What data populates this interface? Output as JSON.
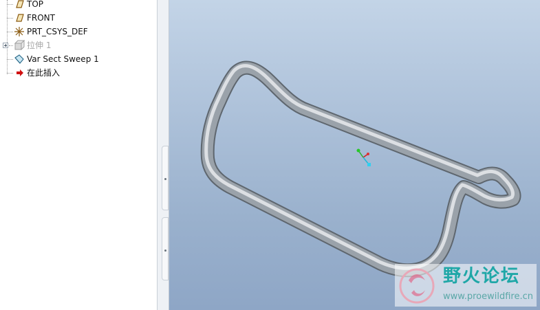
{
  "model_tree": {
    "items": [
      {
        "label": "TOP",
        "icon": "datum-plane-icon",
        "suppressed": false
      },
      {
        "label": "FRONT",
        "icon": "datum-plane-icon",
        "suppressed": false
      },
      {
        "label": "PRT_CSYS_DEF",
        "icon": "coordinate-system-icon",
        "suppressed": false
      },
      {
        "label": "拉伸 1",
        "icon": "extrude-icon",
        "suppressed": true
      },
      {
        "label": "Var Sect Sweep 1",
        "icon": "sweep-icon",
        "suppressed": false
      },
      {
        "label": "在此插入",
        "icon": "insert-here-arrow-icon",
        "suppressed": false
      }
    ]
  },
  "colors": {
    "viewport_top": "#c3d4e7",
    "viewport_bottom": "#8ea6c6",
    "model_fill": "#9aa2aa",
    "watermark_accent": "#1fa7a7",
    "insert_arrow": "#d01010"
  },
  "watermark": {
    "title": "野火论坛",
    "url": "www.proewildfire.cn"
  }
}
